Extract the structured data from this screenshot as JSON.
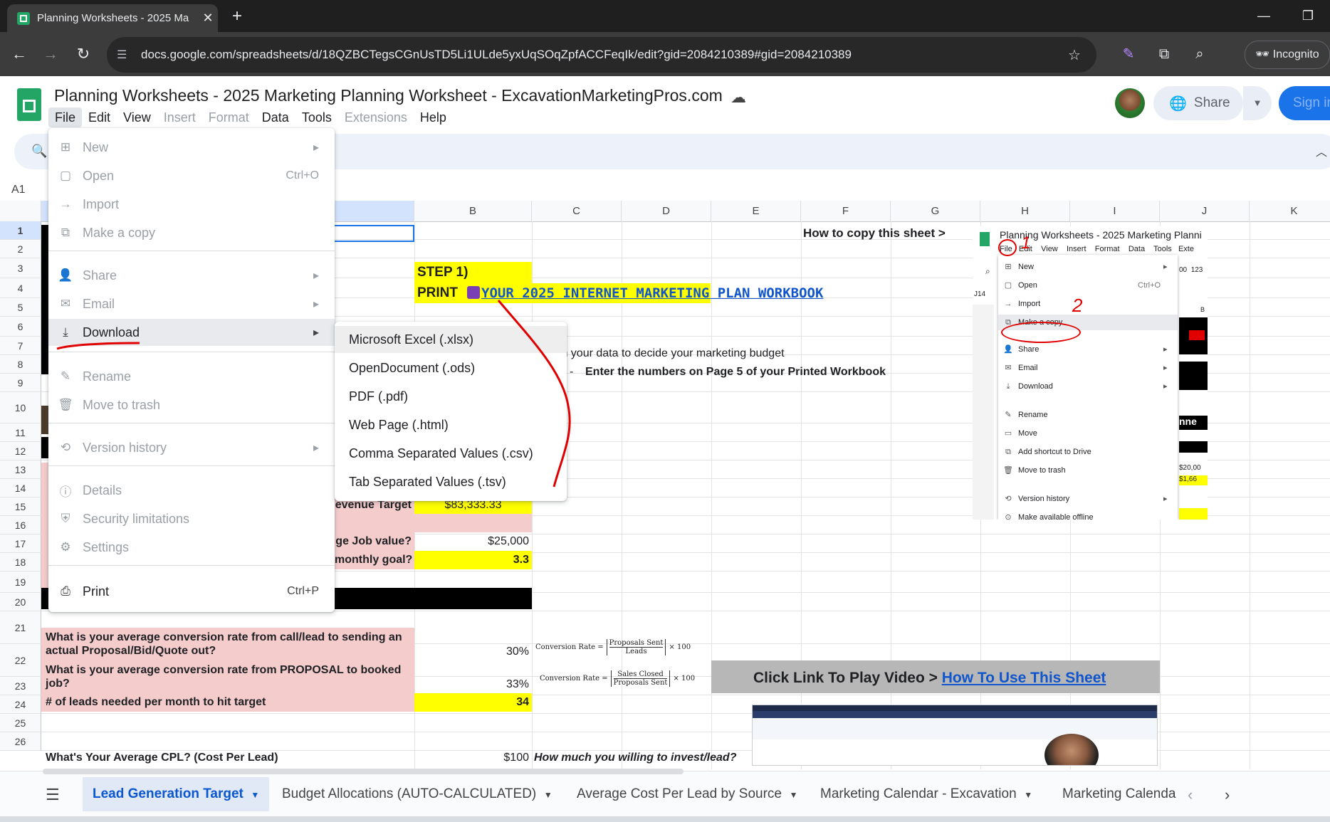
{
  "browser": {
    "tab_title": "Planning Worksheets - 2025 Ma",
    "new_tab": "+",
    "url": "docs.google.com/spreadsheets/d/18QZBCTegsCGnUsTD5Li1ULde5yxUqSOqZpfACCFeqIk/edit?gid=2084210389#gid=2084210389",
    "incognito_label": "Incognito"
  },
  "sheets": {
    "title": "Planning Worksheets - 2025 Marketing Planning Worksheet - ExcavationMarketingPros.com",
    "menus": [
      "File",
      "Edit",
      "View",
      "Insert",
      "Format",
      "Data",
      "Tools",
      "Extensions",
      "Help"
    ],
    "share_label": "Share",
    "signin_label": "Sign in",
    "namebox": "A1"
  },
  "columns": [
    "B",
    "C",
    "D",
    "E",
    "F",
    "G",
    "H",
    "I",
    "J",
    "K"
  ],
  "rows": [
    "1",
    "2",
    "3",
    "4",
    "5",
    "6",
    "7",
    "8",
    "9",
    "10",
    "11",
    "12",
    "13",
    "14",
    "15",
    "16",
    "17",
    "18",
    "19",
    "20",
    "21",
    "22",
    "23",
    "24",
    "25",
    "26"
  ],
  "cells": {
    "how_to_copy": "How to copy this sheet >",
    "step1": "STEP 1)",
    "print_label": "PRINT",
    "workbook_link": " YOUR 2025 INTERNET MARKETING PLAN WORKBOOK",
    "row7_text": "th your data to decide your marketing budget",
    "row8_text_a": "ls - ",
    "row8_text_b": "Enter the numbers on Page 5 of your Printed Workbook",
    "row14_label": "evenue Target",
    "row14_value": "$83,333.33",
    "row16_label": "ge Job  value?",
    "row16_value": "$25,000",
    "row17_label": "monthly goal?",
    "row17_value": "3.3",
    "row21_label": "What is your average conversion rate from call/lead to sending an actual Proposal/Bid/Quote out?",
    "row21_value": "30%",
    "row22_label": "What is your average conversion rate from PROPOSAL to booked job?",
    "row22_value": "33%",
    "row23_label": "# of leads needed per month to hit target",
    "row23_value": "34",
    "row26_label": "What's Your Average CPL? (Cost Per Lead)",
    "row26_value": "$100",
    "row26_note": "How much you willing to invest/lead?",
    "formula1_lhs": "Conversion Rate =",
    "formula1_num": "Proposals Sent",
    "formula1_den": "Leads",
    "formula2_num": "Sales Closed",
    "formula2_den": "Proposals Sent",
    "formula_mult": "× 100",
    "video_prompt": "Click Link To Play Video > ",
    "video_link": "How To Use This Sheet"
  },
  "file_menu": {
    "items": [
      {
        "label": "New",
        "icon": "new-sheet-icon",
        "right": "▸"
      },
      {
        "label": "Open",
        "icon": "folder-icon",
        "right": "Ctrl+O"
      },
      {
        "label": "Import",
        "icon": "import-icon",
        "right": ""
      },
      {
        "label": "Make a copy",
        "icon": "copy-icon",
        "right": ""
      },
      {
        "label": "Share",
        "icon": "share-person-icon",
        "right": "▸"
      },
      {
        "label": "Email",
        "icon": "email-icon",
        "right": "▸"
      },
      {
        "label": "Download",
        "icon": "download-icon",
        "right": "▸"
      },
      {
        "label": "Rename",
        "icon": "pencil-icon",
        "right": ""
      },
      {
        "label": "Move to trash",
        "icon": "trash-icon",
        "right": ""
      },
      {
        "label": "Version history",
        "icon": "history-icon",
        "right": "▸"
      },
      {
        "label": "Details",
        "icon": "info-icon",
        "right": ""
      },
      {
        "label": "Security limitations",
        "icon": "shield-icon",
        "right": ""
      },
      {
        "label": "Settings",
        "icon": "gear-icon",
        "right": ""
      },
      {
        "label": "Print",
        "icon": "printer-icon",
        "right": "Ctrl+P"
      }
    ]
  },
  "download_submenu": [
    "Microsoft Excel (.xlsx)",
    "OpenDocument (.ods)",
    "PDF (.pdf)",
    "Web Page (.html)",
    "Comma Separated Values (.csv)",
    "Tab Separated Values (.tsv)"
  ],
  "inset": {
    "title": "Planning Worksheets - 2025 Marketing Planni",
    "menus": [
      "File",
      "Edit",
      "View",
      "Insert",
      "Format",
      "Data",
      "Tools",
      "Exte"
    ],
    "items": [
      "New",
      "Open",
      "Import",
      "Make a copy",
      "Share",
      "Email",
      "Download",
      "Rename",
      "Move",
      "Add shortcut to Drive",
      "Move to trash",
      "Version history",
      "Make available offline"
    ],
    "open_shortcut": "Ctrl+O",
    "namebox": "J14",
    "annot1": "1",
    "annot2": "2",
    "val1": "$20,00",
    "val2": "$1,66",
    "frag": "nne",
    "toolbar_frag1": "00",
    "toolbar_frag2": "123",
    "col_b": "B"
  },
  "sheet_tabs": [
    "Lead Generation Target",
    "Budget Allocations (AUTO-CALCULATED)",
    "Average Cost Per Lead by Source",
    "Marketing Calendar - Excavation",
    "Marketing Calenda"
  ],
  "colors": {
    "accent": "#0b57d0",
    "pink": "#f4cccc",
    "yellow": "#ffff00",
    "link": "#1155cc",
    "annotation": "#e00000"
  }
}
